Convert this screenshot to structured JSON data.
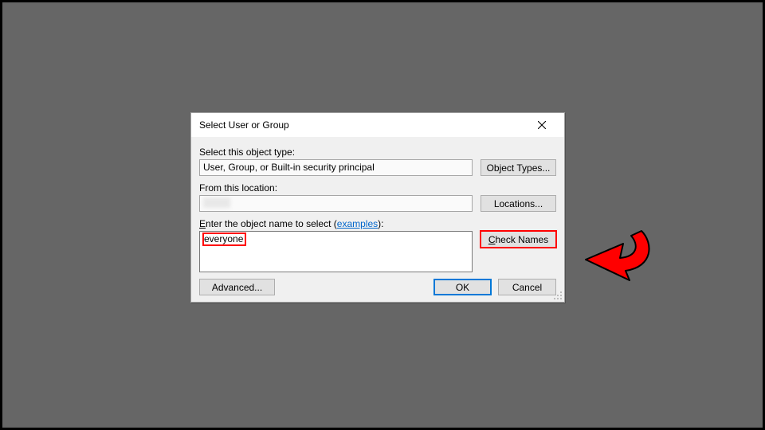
{
  "dialog": {
    "title": "Select User or Group",
    "object_type": {
      "label": "Select this object type:",
      "value": "User, Group, or Built-in security principal",
      "button": "Object Types..."
    },
    "location": {
      "label": "From this location:",
      "value": "",
      "button": "Locations..."
    },
    "object_name": {
      "label_prefix": "E",
      "label_accel": "nter the object name to select (",
      "examples_text": "examples",
      "label_suffix": "):",
      "value": "everyone",
      "button_prefix": "C",
      "button_accel": "heck Names"
    },
    "buttons": {
      "advanced": "Advanced...",
      "ok": "OK",
      "cancel": "Cancel"
    }
  },
  "colors": {
    "highlight": "#ff0000",
    "link": "#0066cc",
    "primary": "#0078d7"
  }
}
